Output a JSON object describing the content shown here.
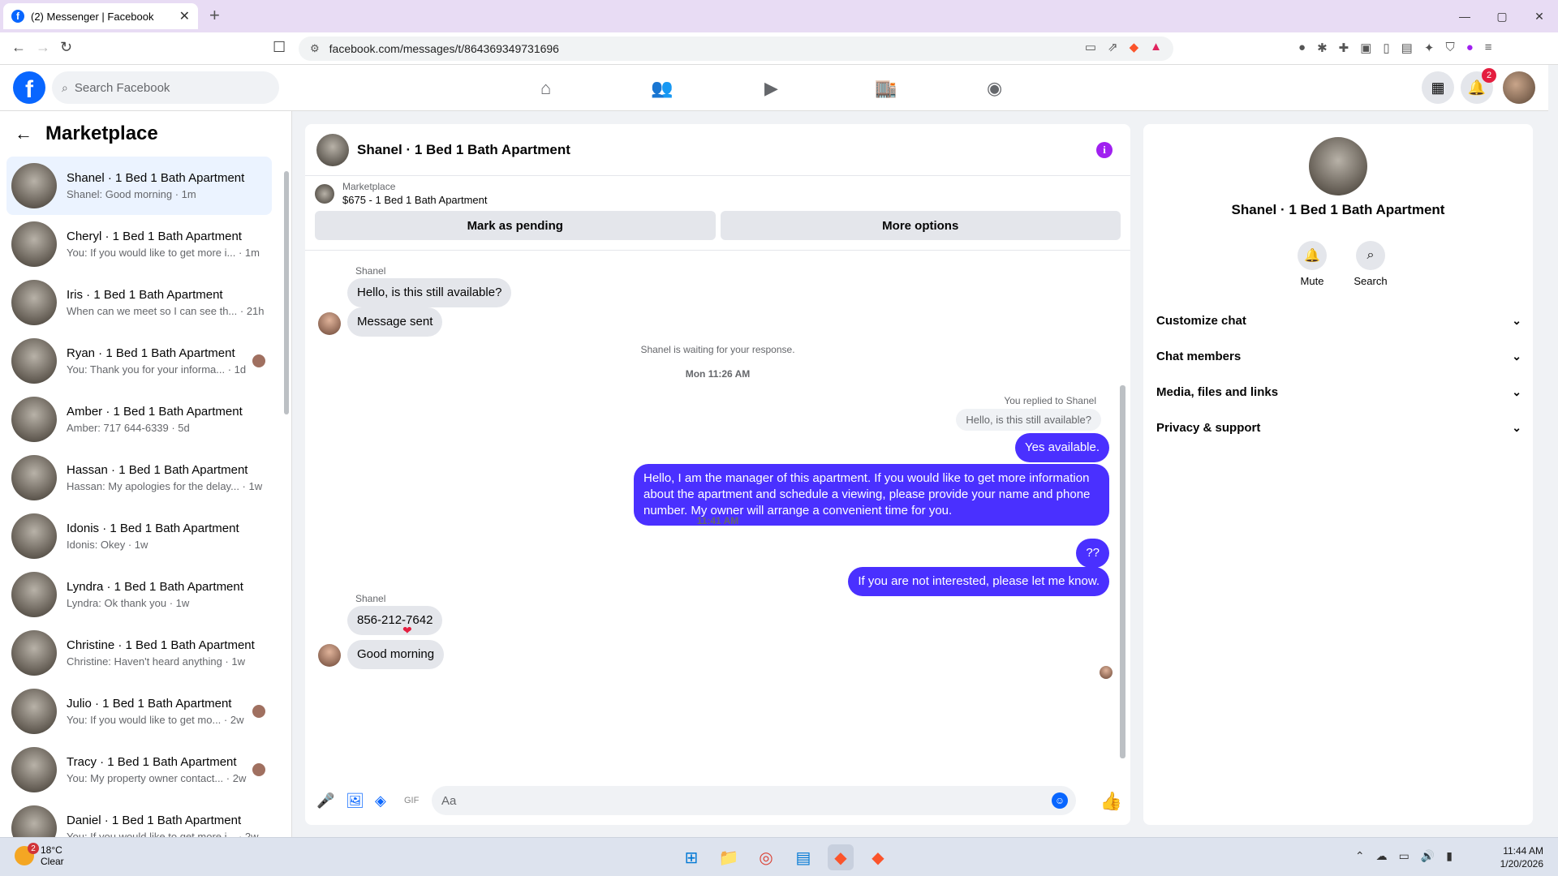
{
  "browser": {
    "tab_title": "(2) Messenger | Facebook",
    "tab_close": "✕",
    "new_tab": "+",
    "url": "facebook.com/messages/t/864369349731696",
    "win_min": "—",
    "win_max": "▢",
    "win_close": "✕"
  },
  "fb_header": {
    "logo": "f",
    "search_placeholder": "Search Facebook",
    "notifications_count": "2"
  },
  "sidebar": {
    "title": "Marketplace",
    "conversations": [
      {
        "name": "Shanel · 1 Bed 1 Bath Apartment",
        "preview": "Shanel: Good morning · 1m"
      },
      {
        "name": "Cheryl · 1 Bed 1 Bath Apartment",
        "preview": "You: If you would like to get more i... · 1m"
      },
      {
        "name": "Iris · 1 Bed 1 Bath Apartment",
        "preview": "When can we meet so I can see th... · 21h"
      },
      {
        "name": "Ryan · 1 Bed 1 Bath Apartment",
        "preview": "You: Thank you for your informa... · 1d"
      },
      {
        "name": "Amber · 1 Bed 1 Bath Apartment",
        "preview": "Amber: 717 644-6339 · 5d"
      },
      {
        "name": "Hassan · 1 Bed 1 Bath Apartment",
        "preview": "Hassan: My apologies for the delay... · 1w"
      },
      {
        "name": "Idonis · 1 Bed 1 Bath Apartment",
        "preview": "Idonis: Okey · 1w"
      },
      {
        "name": "Lyndra · 1 Bed 1 Bath Apartment",
        "preview": "Lyndra: Ok thank you · 1w"
      },
      {
        "name": "Christine · 1 Bed 1 Bath Apartment",
        "preview": "Christine: Haven't heard anything · 1w"
      },
      {
        "name": "Julio · 1 Bed 1 Bath Apartment",
        "preview": "You: If you would like to get mo... · 2w"
      },
      {
        "name": "Tracy · 1 Bed 1 Bath Apartment",
        "preview": "You: My property owner contact... · 2w"
      },
      {
        "name": "Daniel · 1 Bed 1 Bath Apartment",
        "preview": "You: If you would like to get more i... · 2w"
      }
    ]
  },
  "chat": {
    "title": "Shanel · 1 Bed 1 Bath Apartment",
    "marketplace_label": "Marketplace",
    "listing": "$675 - 1 Bed 1 Bath Apartment",
    "mark_pending": "Mark as pending",
    "more_options": "More options",
    "sender_name": "Shanel",
    "msg1": "Hello, is this still available?",
    "msg2": "Message sent",
    "waiting": "Shanel is waiting for your response.",
    "time1": "Mon 11:26 AM",
    "replied_to": "You replied to Shanel",
    "quoted": "Hello, is this still available?",
    "out1": "Yes available.",
    "out2": "Hello, I am the manager of this apartment. If you would like to get more information about the apartment and schedule a viewing, please provide your name and phone number. My owner will arrange a convenient time for you.",
    "time2": "11:41 AM",
    "out3": "??",
    "out4": "If you are not interested, please let me know.",
    "in3": "856-212-7642",
    "in4": "Good morning",
    "composer_placeholder": "Aa"
  },
  "info_panel": {
    "name": "Shanel · 1 Bed 1 Bath Apartment",
    "mute": "Mute",
    "search": "Search",
    "sections": [
      "Customize chat",
      "Chat members",
      "Media, files and links",
      "Privacy & support"
    ]
  },
  "taskbar": {
    "temp": "18°C",
    "condition": "Clear",
    "weather_badge": "2",
    "time": "11:44 AM",
    "date": "1/20/2026"
  }
}
